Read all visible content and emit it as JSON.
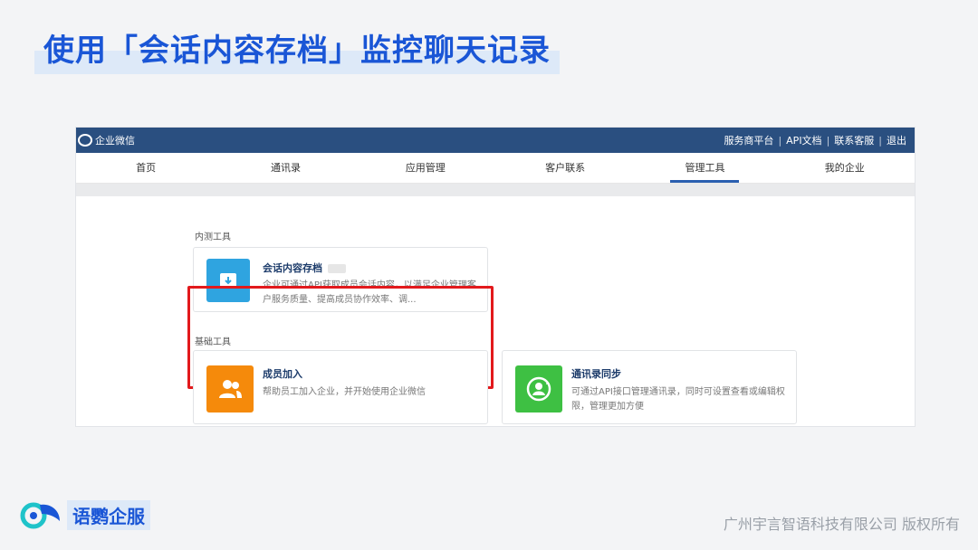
{
  "slide": {
    "title": "使用「会话内容存档」监控聊天记录"
  },
  "screenshot": {
    "topbar": {
      "brand": "企业微信",
      "links": [
        "服务商平台",
        "API文档",
        "联系客服",
        "退出"
      ]
    },
    "nav": {
      "items": [
        "首页",
        "通讯录",
        "应用管理",
        "客户联系",
        "管理工具",
        "我的企业"
      ],
      "active_index": 4
    },
    "sections": {
      "internal_label": "内测工具",
      "basic_label": "基础工具"
    },
    "cards": {
      "archive": {
        "title": "会话内容存档",
        "desc": "企业可通过API获取成员会话内容，以满足企业管理客户服务质量、提高成员协作效率、调..."
      },
      "member_join": {
        "title": "成员加入",
        "desc": "帮助员工加入企业，并开始使用企业微信"
      },
      "contacts_sync": {
        "title": "通讯录同步",
        "desc": "可通过API接口管理通讯录，同时可设置查看或编辑权限，管理更加方便"
      }
    }
  },
  "footer": {
    "logo_text": "语鹦企服",
    "copyright": "广州宇言智语科技有限公司 版权所有"
  },
  "colors": {
    "title_blue": "#1a56d6",
    "topbar_navy": "#2a4f80",
    "highlight_red": "#e2191c",
    "archive_icon": "#2fa4e0",
    "member_icon": "#f58a0b",
    "sync_icon": "#3ec043"
  }
}
